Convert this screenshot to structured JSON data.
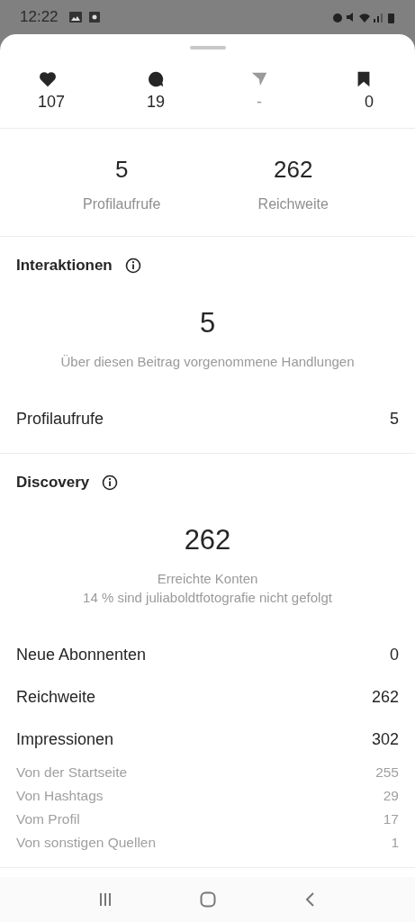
{
  "status_bar": {
    "time": "12:22"
  },
  "engagement": [
    {
      "kind": "like",
      "value": "107",
      "disabled": false
    },
    {
      "kind": "comment",
      "value": "19",
      "disabled": false
    },
    {
      "kind": "share",
      "value": "-",
      "disabled": true
    },
    {
      "kind": "save",
      "value": "0",
      "disabled": false
    }
  ],
  "summary": [
    {
      "value": "5",
      "label": "Profilaufrufe"
    },
    {
      "value": "262",
      "label": "Reichweite"
    }
  ],
  "sections": [
    {
      "title": "Interaktionen",
      "big_value": "5",
      "captions": [
        "Über diesen Beitrag vorgenommene Handlungen"
      ],
      "rows": [
        {
          "kind": "main",
          "label": "Profilaufrufe",
          "value": "5"
        }
      ]
    },
    {
      "title": "Discovery",
      "big_value": "262",
      "captions": [
        "Erreichte Konten",
        "14 % sind juliaboldtfotografie nicht gefolgt"
      ],
      "rows": [
        {
          "kind": "main",
          "label": "Neue Abonnenten",
          "value": "0"
        },
        {
          "kind": "main",
          "label": "Reichweite",
          "value": "262"
        },
        {
          "kind": "main",
          "label": "Impressionen",
          "value": "302"
        },
        {
          "kind": "sub",
          "label": "Von der Startseite",
          "value": "255"
        },
        {
          "kind": "sub",
          "label": "Von Hashtags",
          "value": "29"
        },
        {
          "kind": "sub",
          "label": "Vom Profil",
          "value": "17"
        },
        {
          "kind": "sub",
          "label": "Von sonstigen Quellen",
          "value": "1"
        }
      ]
    }
  ]
}
